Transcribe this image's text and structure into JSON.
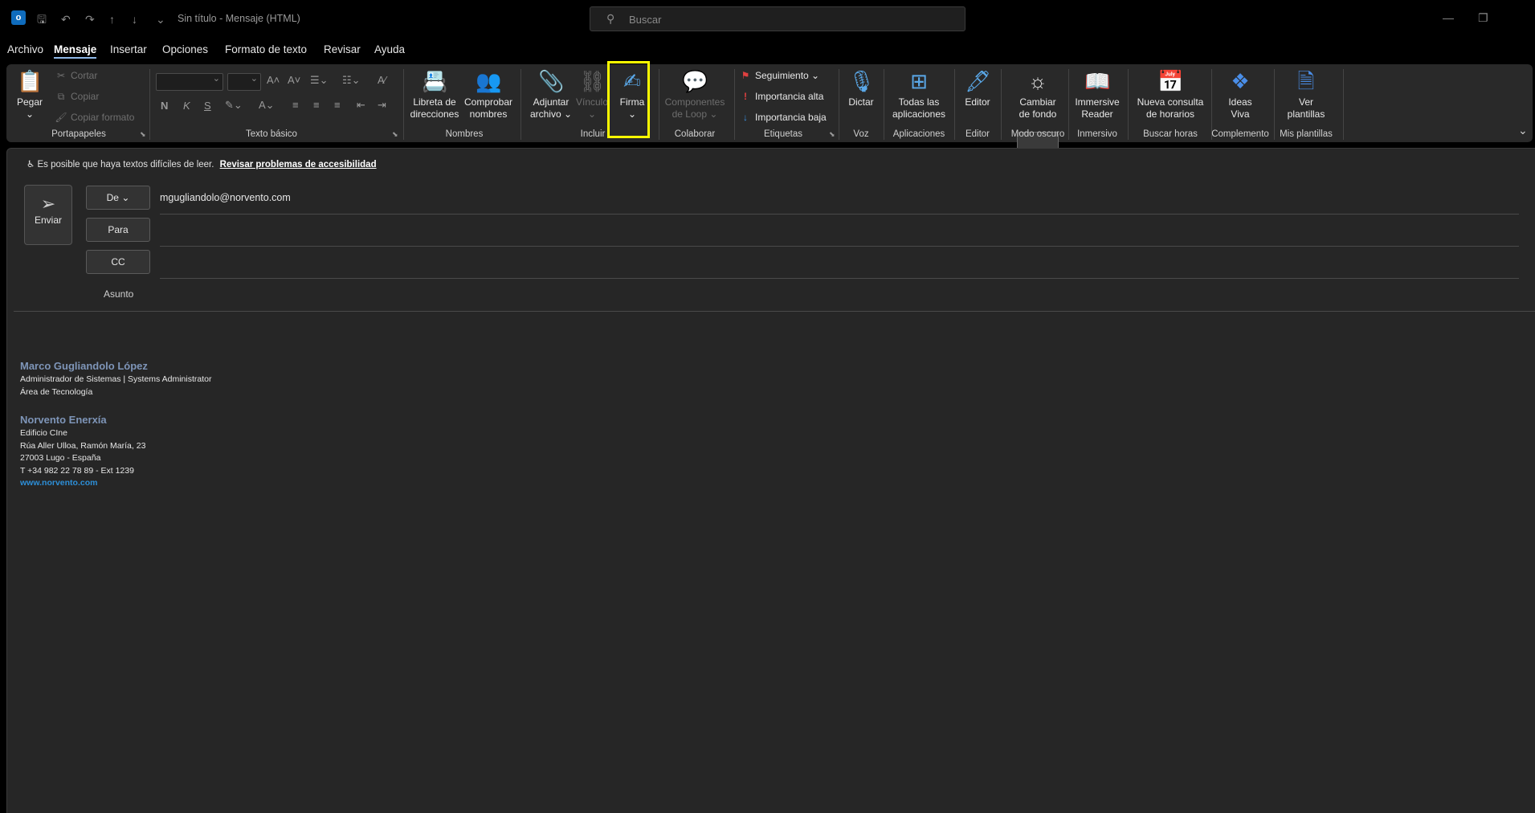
{
  "titlebar": {
    "logo_letter": "o",
    "doc_title": "Sin título  -  Mensaje (HTML)",
    "search_placeholder": "Buscar"
  },
  "tabs": [
    "Archivo",
    "Mensaje",
    "Insertar",
    "Opciones",
    "Formato de texto",
    "Revisar",
    "Ayuda"
  ],
  "active_tab": "Mensaje",
  "ribbon": {
    "portapapeles": {
      "label": "Portapapeles",
      "paste": "Pegar",
      "cut": "Cortar",
      "copy": "Copiar",
      "format_painter": "Copiar formato"
    },
    "texto_basico": {
      "label": "Texto básico",
      "bold": "N",
      "italic": "K",
      "underline": "S"
    },
    "nombres": {
      "label": "Nombres",
      "address_book": [
        "Libreta de",
        "direcciones"
      ],
      "check_names": [
        "Comprobar",
        "nombres"
      ]
    },
    "incluir": {
      "label": "Incluir",
      "attach": [
        "Adjuntar",
        "archivo ⌄"
      ],
      "link": "Vínculo",
      "signature": "Firma"
    },
    "colaborar": {
      "label": "Colaborar",
      "loop": [
        "Componentes",
        "de Loop ⌄"
      ]
    },
    "etiquetas": {
      "label": "Etiquetas",
      "follow_up": "Seguimiento ⌄",
      "high": "Importancia alta",
      "low": "Importancia baja"
    },
    "voz": {
      "label": "Voz",
      "dictate": "Dictar"
    },
    "aplicaciones": {
      "label": "Aplicaciones",
      "all_apps": [
        "Todas las",
        "aplicaciones"
      ]
    },
    "editor": {
      "label": "Editor",
      "editor": "Editor"
    },
    "modo_oscuro": {
      "label": "Modo oscuro",
      "switch_bg": [
        "Cambiar",
        "de fondo"
      ]
    },
    "inmersivo": {
      "label": "Inmersivo",
      "reader": [
        "Immersive",
        "Reader"
      ]
    },
    "buscar_horas": {
      "label": "Buscar horas",
      "new_poll": [
        "Nueva consulta",
        "de horarios"
      ]
    },
    "complemento": {
      "label": "Complemento",
      "viva": [
        "Ideas",
        "Viva"
      ]
    },
    "plantillas": {
      "label": "Mis plantillas",
      "view": [
        "Ver",
        "plantillas"
      ]
    }
  },
  "compose": {
    "a11y_notice": "Es posible que haya textos difíciles de leer.",
    "a11y_link": "Revisar problemas de accesibilidad",
    "send": "Enviar",
    "from_label": "De",
    "from_value": "mgugliandolo@norvento.com",
    "to_label": "Para",
    "cc_label": "CC",
    "subject_label": "Asunto"
  },
  "signature": {
    "name": "Marco Gugliandolo López",
    "role": "Administrador de Sistemas | Systems Administrator",
    "department": "Área de Tecnología",
    "company": "Norvento Enerxía",
    "building": "Edificio CIne",
    "street": "Rúa Aller Ulloa, Ramón María, 23",
    "city": "27003 Lugo - España",
    "phone": "T +34 982 22 78 89 - Ext 1239",
    "website": "www.norvento.com"
  },
  "colors": {
    "accent": "#ffff00",
    "link": "#2d8fd8",
    "name": "#7e95b8"
  }
}
